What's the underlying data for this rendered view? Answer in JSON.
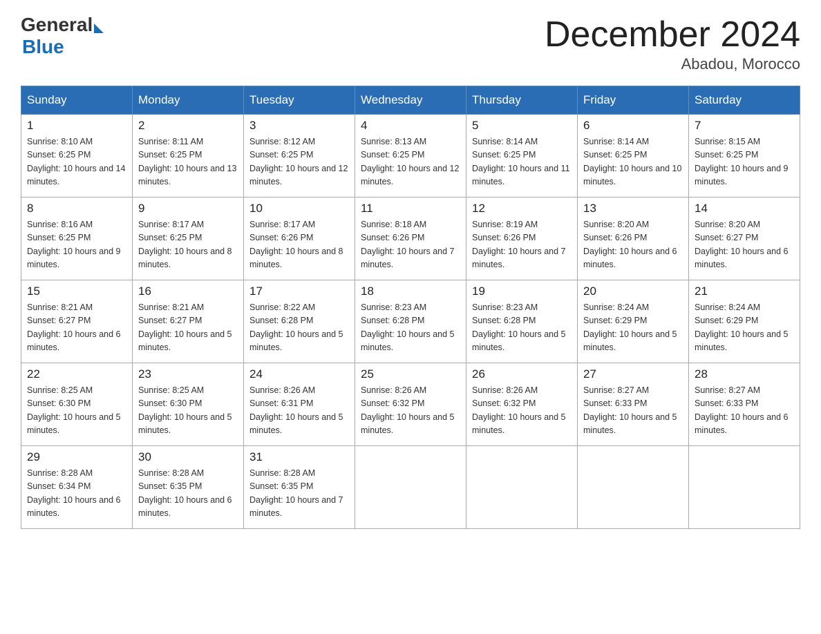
{
  "header": {
    "logo_general": "General",
    "logo_blue": "Blue",
    "month_title": "December 2024",
    "subtitle": "Abadou, Morocco"
  },
  "weekdays": [
    "Sunday",
    "Monday",
    "Tuesday",
    "Wednesday",
    "Thursday",
    "Friday",
    "Saturday"
  ],
  "weeks": [
    [
      {
        "day": "1",
        "sunrise": "8:10 AM",
        "sunset": "6:25 PM",
        "daylight": "10 hours and 14 minutes."
      },
      {
        "day": "2",
        "sunrise": "8:11 AM",
        "sunset": "6:25 PM",
        "daylight": "10 hours and 13 minutes."
      },
      {
        "day": "3",
        "sunrise": "8:12 AM",
        "sunset": "6:25 PM",
        "daylight": "10 hours and 12 minutes."
      },
      {
        "day": "4",
        "sunrise": "8:13 AM",
        "sunset": "6:25 PM",
        "daylight": "10 hours and 12 minutes."
      },
      {
        "day": "5",
        "sunrise": "8:14 AM",
        "sunset": "6:25 PM",
        "daylight": "10 hours and 11 minutes."
      },
      {
        "day": "6",
        "sunrise": "8:14 AM",
        "sunset": "6:25 PM",
        "daylight": "10 hours and 10 minutes."
      },
      {
        "day": "7",
        "sunrise": "8:15 AM",
        "sunset": "6:25 PM",
        "daylight": "10 hours and 9 minutes."
      }
    ],
    [
      {
        "day": "8",
        "sunrise": "8:16 AM",
        "sunset": "6:25 PM",
        "daylight": "10 hours and 9 minutes."
      },
      {
        "day": "9",
        "sunrise": "8:17 AM",
        "sunset": "6:25 PM",
        "daylight": "10 hours and 8 minutes."
      },
      {
        "day": "10",
        "sunrise": "8:17 AM",
        "sunset": "6:26 PM",
        "daylight": "10 hours and 8 minutes."
      },
      {
        "day": "11",
        "sunrise": "8:18 AM",
        "sunset": "6:26 PM",
        "daylight": "10 hours and 7 minutes."
      },
      {
        "day": "12",
        "sunrise": "8:19 AM",
        "sunset": "6:26 PM",
        "daylight": "10 hours and 7 minutes."
      },
      {
        "day": "13",
        "sunrise": "8:20 AM",
        "sunset": "6:26 PM",
        "daylight": "10 hours and 6 minutes."
      },
      {
        "day": "14",
        "sunrise": "8:20 AM",
        "sunset": "6:27 PM",
        "daylight": "10 hours and 6 minutes."
      }
    ],
    [
      {
        "day": "15",
        "sunrise": "8:21 AM",
        "sunset": "6:27 PM",
        "daylight": "10 hours and 6 minutes."
      },
      {
        "day": "16",
        "sunrise": "8:21 AM",
        "sunset": "6:27 PM",
        "daylight": "10 hours and 5 minutes."
      },
      {
        "day": "17",
        "sunrise": "8:22 AM",
        "sunset": "6:28 PM",
        "daylight": "10 hours and 5 minutes."
      },
      {
        "day": "18",
        "sunrise": "8:23 AM",
        "sunset": "6:28 PM",
        "daylight": "10 hours and 5 minutes."
      },
      {
        "day": "19",
        "sunrise": "8:23 AM",
        "sunset": "6:28 PM",
        "daylight": "10 hours and 5 minutes."
      },
      {
        "day": "20",
        "sunrise": "8:24 AM",
        "sunset": "6:29 PM",
        "daylight": "10 hours and 5 minutes."
      },
      {
        "day": "21",
        "sunrise": "8:24 AM",
        "sunset": "6:29 PM",
        "daylight": "10 hours and 5 minutes."
      }
    ],
    [
      {
        "day": "22",
        "sunrise": "8:25 AM",
        "sunset": "6:30 PM",
        "daylight": "10 hours and 5 minutes."
      },
      {
        "day": "23",
        "sunrise": "8:25 AM",
        "sunset": "6:30 PM",
        "daylight": "10 hours and 5 minutes."
      },
      {
        "day": "24",
        "sunrise": "8:26 AM",
        "sunset": "6:31 PM",
        "daylight": "10 hours and 5 minutes."
      },
      {
        "day": "25",
        "sunrise": "8:26 AM",
        "sunset": "6:32 PM",
        "daylight": "10 hours and 5 minutes."
      },
      {
        "day": "26",
        "sunrise": "8:26 AM",
        "sunset": "6:32 PM",
        "daylight": "10 hours and 5 minutes."
      },
      {
        "day": "27",
        "sunrise": "8:27 AM",
        "sunset": "6:33 PM",
        "daylight": "10 hours and 5 minutes."
      },
      {
        "day": "28",
        "sunrise": "8:27 AM",
        "sunset": "6:33 PM",
        "daylight": "10 hours and 6 minutes."
      }
    ],
    [
      {
        "day": "29",
        "sunrise": "8:28 AM",
        "sunset": "6:34 PM",
        "daylight": "10 hours and 6 minutes."
      },
      {
        "day": "30",
        "sunrise": "8:28 AM",
        "sunset": "6:35 PM",
        "daylight": "10 hours and 6 minutes."
      },
      {
        "day": "31",
        "sunrise": "8:28 AM",
        "sunset": "6:35 PM",
        "daylight": "10 hours and 7 minutes."
      },
      null,
      null,
      null,
      null
    ]
  ]
}
